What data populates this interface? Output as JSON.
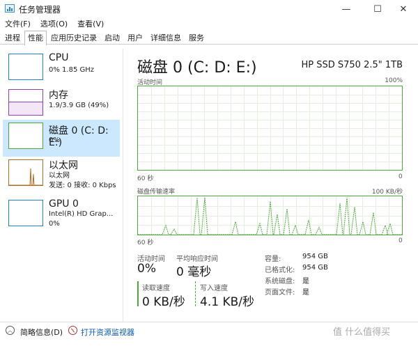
{
  "window": {
    "title": "任务管理器",
    "minimize": "—",
    "maximize": "☐",
    "close": "✕"
  },
  "menu": [
    "文件(F)",
    "选项(O)",
    "查看(V)"
  ],
  "tabs": [
    "进程",
    "性能",
    "应用历史记录",
    "启动",
    "用户",
    "详细信息",
    "服务"
  ],
  "active_tab": "性能",
  "sidebar": [
    {
      "title": "CPU",
      "sub1": "0% 1.85 GHz",
      "sub2": "",
      "color": "#1f7fd8"
    },
    {
      "title": "内存",
      "sub1": "1.9/3.9 GB (49%)",
      "sub2": "",
      "color": "#8e3fb0",
      "fill_pct": 49
    },
    {
      "title": "磁盘 0 (C: D: E:)",
      "sub1": "0%",
      "sub2": "",
      "color": "#4aa83a",
      "selected": true
    },
    {
      "title": "以太网",
      "sub1": "以太网",
      "sub2": "发送: 0 接收: 0 Kbps",
      "color": "#b5691f"
    },
    {
      "title": "GPU 0",
      "sub1": "Intel(R) HD Grap...",
      "sub2": "0%",
      "color": "#1f7fd8"
    }
  ],
  "main": {
    "title": "磁盘 0 (C: D: E:)",
    "model": "HP SSD S750 2.5\" 1TB",
    "graph1": {
      "label": "活动时间",
      "max": "100%",
      "time": "60 秒",
      "min": "0"
    },
    "graph2": {
      "label": "磁盘传输速率",
      "max": "100 KB/秒",
      "time": "60 秒",
      "min": "0"
    },
    "stats": {
      "active_label": "活动时间",
      "active_value": "0%",
      "resp_label": "平均响应时间",
      "resp_value": "0 毫秒",
      "read_label": "读取速度",
      "read_value": "0 KB/秒",
      "write_label": "写入速度",
      "write_value": "4.1 KB/秒"
    },
    "info": [
      {
        "k": "容量:",
        "v": "954 GB"
      },
      {
        "k": "已格式化:",
        "v": "954 GB"
      },
      {
        "k": "系统磁盘:",
        "v": "是"
      },
      {
        "k": "页面文件:",
        "v": "是"
      }
    ]
  },
  "footer": {
    "summary": "简略信息(D)",
    "monitor": "打开资源监视器"
  },
  "watermark": "值 什么值得买"
}
